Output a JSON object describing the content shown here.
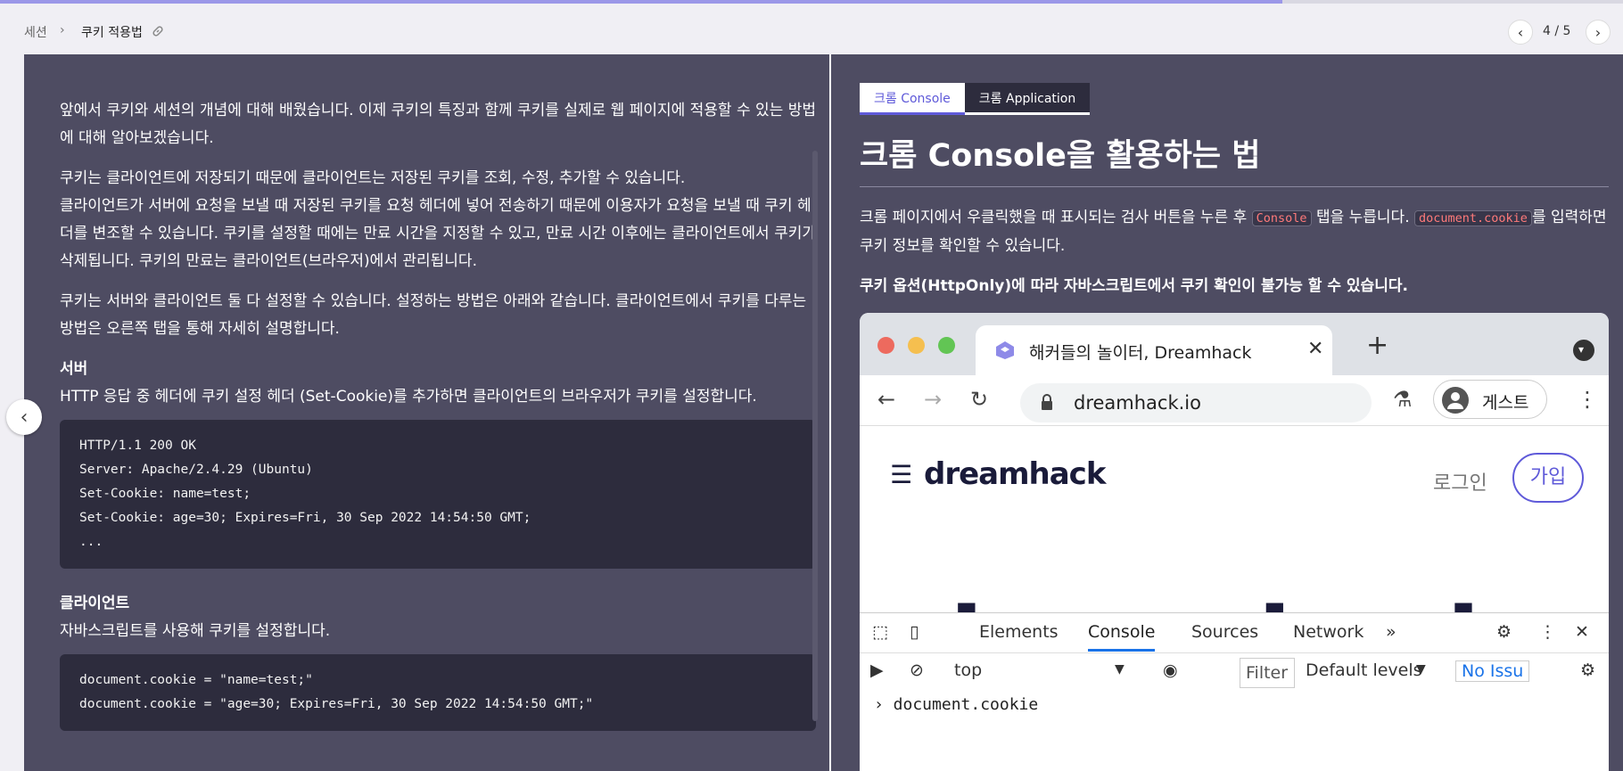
{
  "progress": {
    "fraction": 0.79
  },
  "breadcrumb": {
    "parent": "세션",
    "current": "쿠키 적용법"
  },
  "pager": {
    "text": "4 / 5"
  },
  "left": {
    "p1": "앞에서 쿠키와 세션의 개념에 대해 배웠습니다. 이제 쿠키의 특징과 함께 쿠키를 실제로 웹 페이지에 적용할 수 있는 방법에 대해 알아보겠습니다.",
    "p2a": "쿠키는 클라이언트에 저장되기 때문에 클라이언트는 저장된 쿠키를 조회, 수정, 추가할 수 있습니다.",
    "p2b": "클라이언트가 서버에 요청을 보낼 때 저장된 쿠키를 요청 헤더에 넣어 전송하기 때문에 이용자가 요청을 보낼 때 쿠키 헤더를 변조할 수 있습니다. 쿠키를 설정할 때에는 만료 시간을 지정할 수 있고, 만료 시간 이후에는 클라이언트에서 쿠키가 삭제됩니다. 쿠키의 만료는 클라이언트(브라우저)에서 관리됩니다.",
    "p3": "쿠키는 서버와 클라이언트 둘 다 설정할 수 있습니다. 설정하는 방법은 아래와 같습니다. 클라이언트에서 쿠키를 다루는 방법은 오른쪽 탭을 통해 자세히 설명합니다.",
    "server_heading": "서버",
    "server_desc": "HTTP 응답 중 헤더에 쿠키 설정 헤더 (Set-Cookie)를 추가하면 클라이언트의 브라우저가 쿠키를 설정합니다.",
    "server_code": [
      "HTTP/1.1 200 OK",
      "Server: Apache/2.4.29 (Ubuntu)",
      "Set-Cookie: name=test;",
      "Set-Cookie: age=30; Expires=Fri, 30 Sep 2022 14:54:50 GMT;",
      "..."
    ],
    "client_heading": "클라이언트",
    "client_desc": "자바스크립트를 사용해 쿠키를 설정합니다.",
    "client_code": [
      "document.cookie = \"name=test;\"",
      "document.cookie = \"age=30; Expires=Fri, 30 Sep 2022 14:54:50 GMT;\""
    ]
  },
  "right": {
    "tabs": [
      "크롬 Console",
      "크롬 Application"
    ],
    "title": "크롬 Console을 활용하는 법",
    "p1_a": "크롬 페이지에서 우클릭했을 때 표시되는 검사 버튼을 누른 후 ",
    "p1_code1": "Console",
    "p1_b": " 탭을 누릅니다. ",
    "p1_code2": "document.cookie",
    "p1_c": "를 입력하면 쿠키 정보를 확인할 수 있습니다.",
    "p2": "쿠키 옵션(HttpOnly)에 따라 자바스크립트에서 쿠키 확인이 불가능 할 수 있습니다."
  },
  "browser": {
    "tab_title": "해커들의 놀이터, Dreamhack",
    "url": "dreamhack.io",
    "profile": "게스트",
    "site_logo": "dreamhack",
    "login": "로그인",
    "join": "가입",
    "big_text": "dreamhack",
    "devtools_tabs": [
      "Elements",
      "Console",
      "Sources",
      "Network",
      "»"
    ],
    "context": "top",
    "filter": "Filter",
    "levels": "Default levels",
    "issues": "No Issu",
    "console_line": "› document.cookie"
  },
  "colors": {
    "accent": "#5f5ad9",
    "panel": "#4e4c62",
    "code_bg": "#2d2c3d",
    "inline_code": "#ff7a7a"
  }
}
